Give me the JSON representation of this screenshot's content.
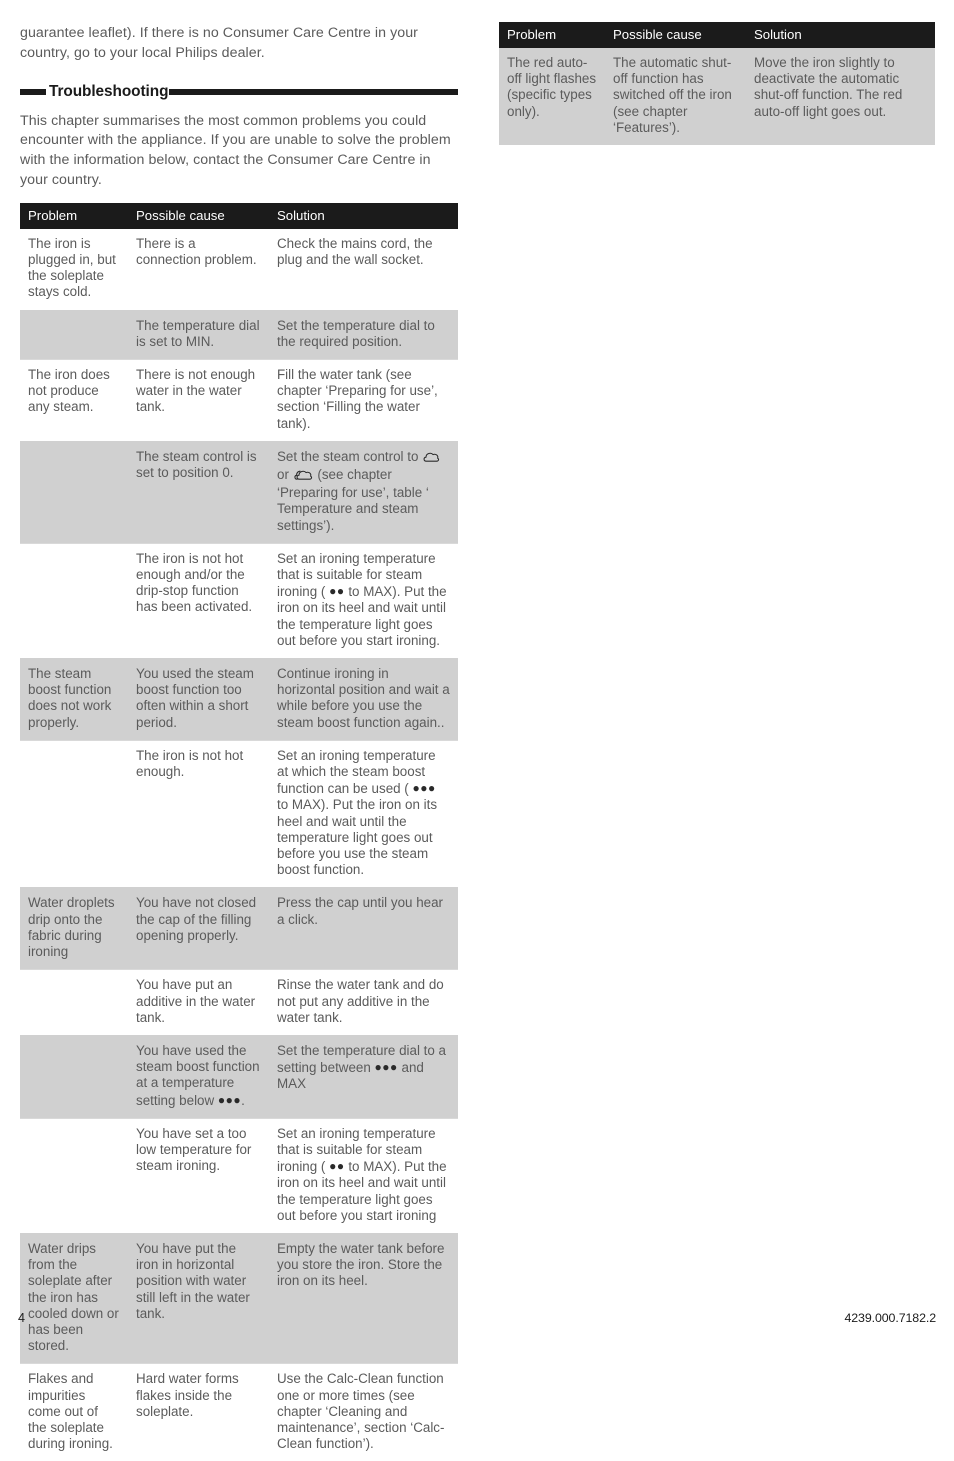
{
  "document": {
    "intro_paragraph": "guarantee leaflet). If there is no Consumer Care Centre in your country, go to your local Philips dealer.",
    "section_heading": "Troubleshooting",
    "section_paragraph": "This chapter summarises the most common problems you could encounter with the appliance. If you are unable to solve the problem with the information below, contact the Consumer Care Centre in your country.",
    "page_number": "4",
    "doc_code": "4239.000.7182.2"
  },
  "table_headers": {
    "problem": "Problem",
    "cause": "Possible cause",
    "solution": "Solution"
  },
  "left_table": {
    "rows": [
      {
        "shade": "white",
        "problem": "The iron is plugged in, but the soleplate stays cold.",
        "cause": "There is a connection problem.",
        "solution": "Check the mains cord, the plug and the wall socket."
      },
      {
        "shade": "gray",
        "problem": "",
        "cause": "The temperature dial is set to MIN.",
        "solution": "Set the temperature dial to the required position."
      },
      {
        "shade": "white",
        "problem": "The iron does not produce any steam.",
        "cause": "There is not enough water in the water tank.",
        "solution": "Fill the water tank (see chapter ‘Preparing for use’, section ‘Filling the water tank)."
      },
      {
        "shade": "gray",
        "problem": "",
        "cause": "The steam control is set to position 0.",
        "solution_pre": "Set the steam control to ",
        "solution_mid": " or ",
        "solution_post": " (see chapter ‘Preparing for use’, table ‘ Temperature and steam settings’).",
        "symbols": [
          "steam-single-icon",
          "steam-double-icon"
        ]
      },
      {
        "shade": "white",
        "problem": "",
        "cause": "The iron is not hot enough and/or the drip-stop function has been activated.",
        "solution_pre": "Set an ironing temperature that is suitable for steam ironing ( ",
        "solution_dots": "●●",
        "solution_post": " to MAX). Put the iron on its heel and wait until the temperature light goes out before you start ironing."
      },
      {
        "shade": "gray",
        "problem": "The steam boost function does not work properly.",
        "cause": "You used the steam boost function too often within a short period.",
        "solution": "Continue ironing in horizontal position and wait a while before you use the steam boost function again.."
      },
      {
        "shade": "white",
        "problem": "",
        "cause": "The iron is not hot enough.",
        "solution_pre": "Set an ironing temperature at which the steam boost function can be used ( ",
        "solution_dots": "●●●",
        "solution_post": "  to MAX). Put the iron on its heel and wait until the temperature light goes out before you use the steam boost function."
      },
      {
        "shade": "gray",
        "problem": "Water droplets drip onto the fabric during ironing",
        "cause": "You have not closed the cap of the filling opening properly.",
        "solution": "Press the cap until you hear a click."
      },
      {
        "shade": "white",
        "problem": "",
        "cause": "You have put an additive in the water tank.",
        "solution": "Rinse the water tank and do not put any additive in the water tank."
      },
      {
        "shade": "gray",
        "problem": "",
        "cause_pre": "You have used the steam boost function at a temperature setting below ",
        "cause_dots": "●●●",
        "cause_post": ".",
        "solution_pre": "Set the temperature dial to a setting between ",
        "solution_dots": "●●●",
        "solution_post": " and MAX"
      },
      {
        "shade": "white",
        "problem": "",
        "cause": "You have set a too low temperature for steam ironing.",
        "solution_pre": "Set an ironing temperature that is suitable for steam ironing ( ",
        "solution_dots": "●●",
        "solution_post": " to MAX). Put the iron on its heel and wait until the temperature light goes out before you start ironing"
      },
      {
        "shade": "gray",
        "problem": "Water drips from the soleplate after the iron has cooled down or has been stored.",
        "cause": "You have put the iron in horizontal position with water still left in the water tank.",
        "solution": "Empty the water tank before you store the iron. Store the iron on its heel."
      },
      {
        "shade": "white",
        "problem": "Flakes and impurities come out of the soleplate during ironing.",
        "cause": "Hard water forms flakes inside the soleplate.",
        "solution": "Use the Calc-Clean function one or more times (see chapter ‘Cleaning and maintenance’, section ‘Calc-Clean function’)."
      }
    ]
  },
  "right_table": {
    "rows": [
      {
        "shade": "gray",
        "problem": "The red auto-off light flashes (specific types only).",
        "cause": "The automatic shut-off function has switched off the iron (see chapter ‘Features’).",
        "solution": "Move the iron slightly to deactivate the automatic shut-off function. The red auto-off light goes out."
      }
    ]
  },
  "colors": {
    "header_bar": "#1b1b1b",
    "row_gray": "#d0d0d0",
    "text": "#5b5b5b"
  }
}
